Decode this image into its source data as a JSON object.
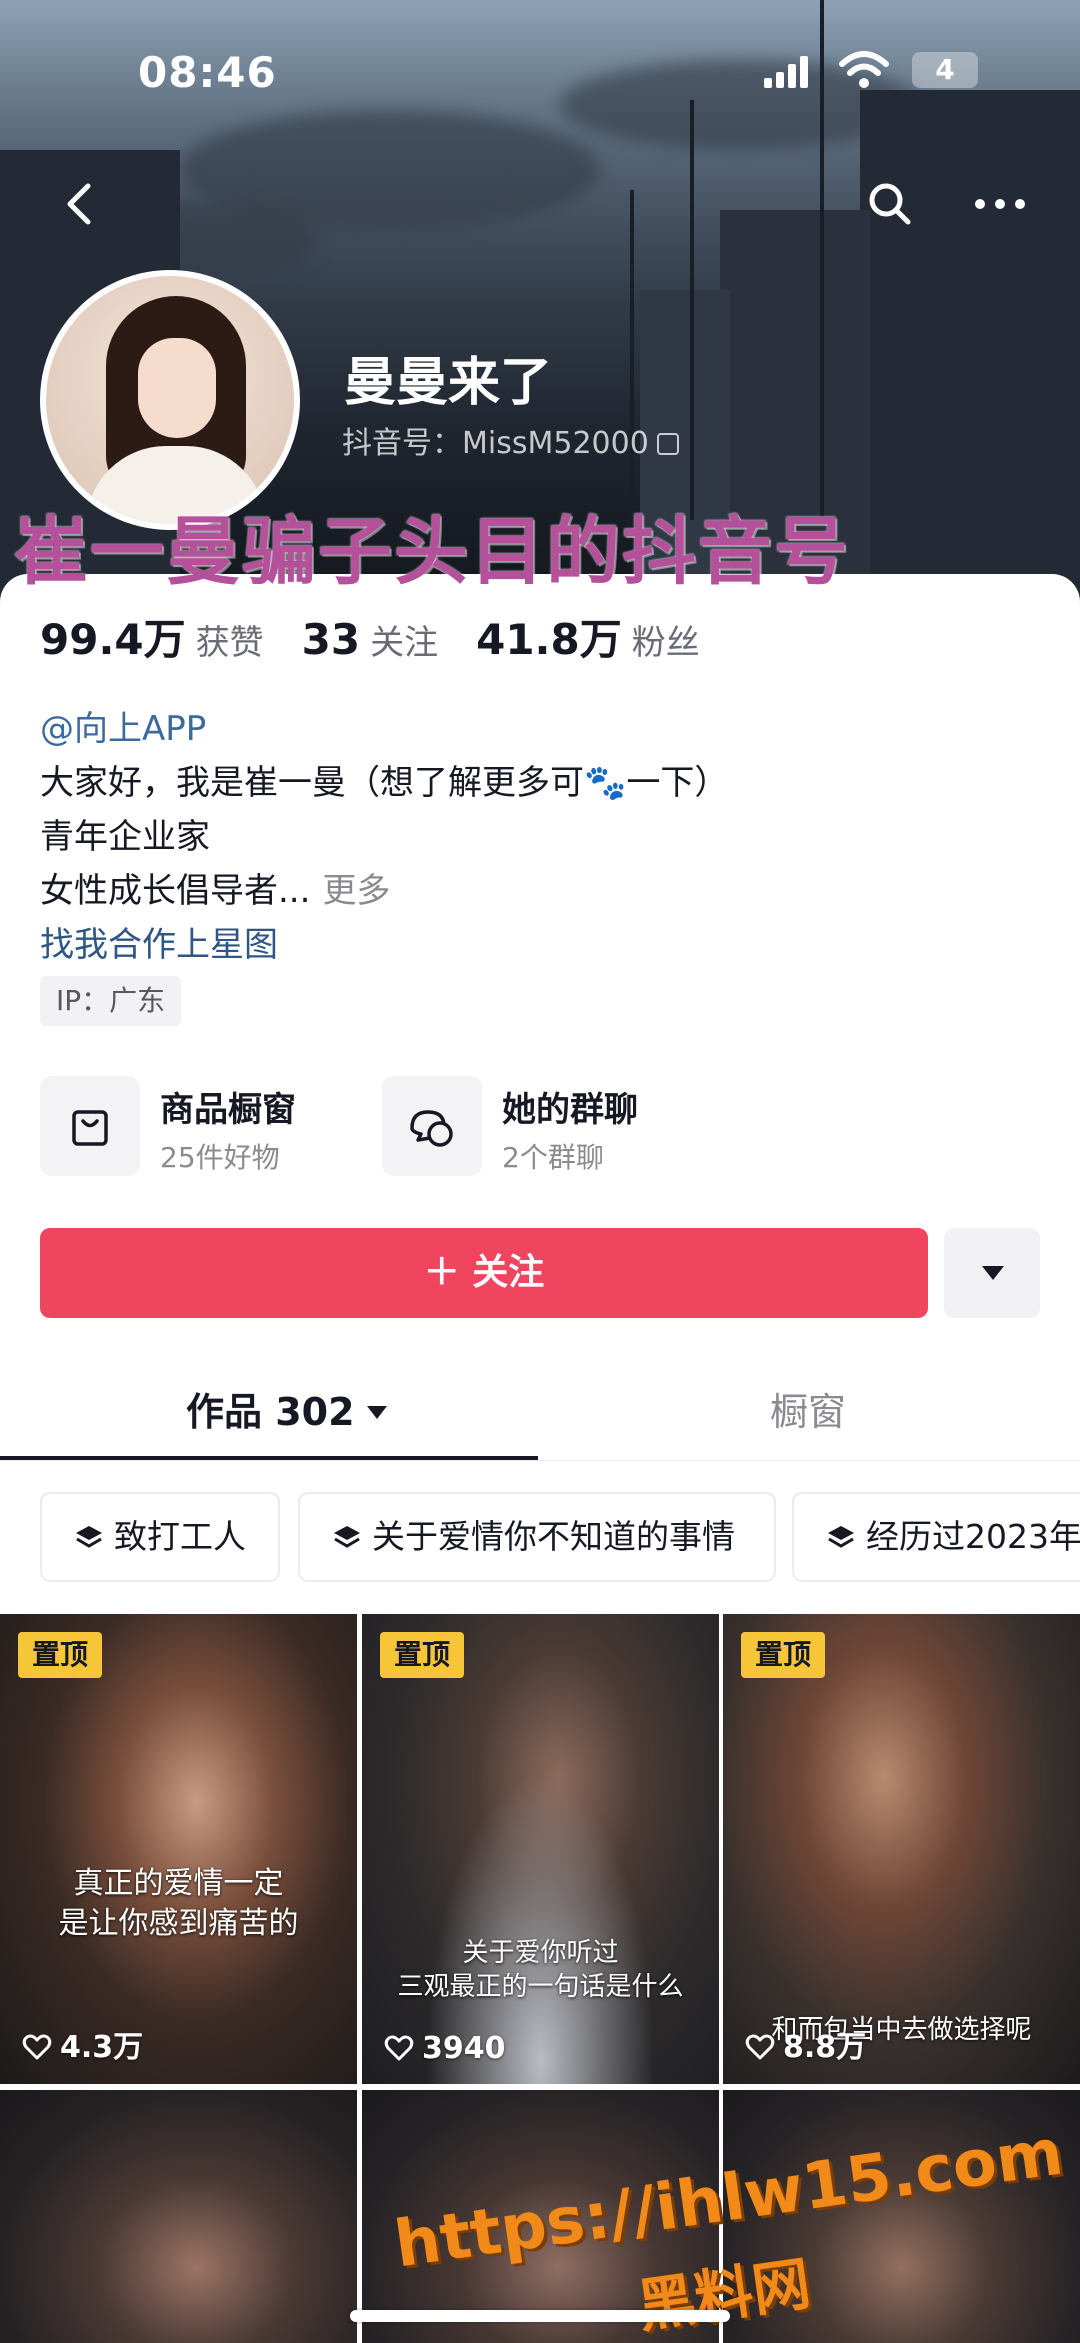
{
  "status_bar": {
    "time": "08:46",
    "battery": "4"
  },
  "profile": {
    "nickname": "曼曼来了",
    "douyin_id": "抖音号：MissM52000"
  },
  "overlay_banner": "崔一曼骗子头目的抖音号",
  "stats": [
    {
      "value": "99.4万",
      "label": "获赞"
    },
    {
      "value": "33",
      "label": "关注"
    },
    {
      "value": "41.8万",
      "label": "粉丝"
    }
  ],
  "bio": {
    "mention": "@向上APP",
    "line1": "大家好，我是崔一曼（想了解更多可🐾一下）",
    "line2": "青年企业家",
    "line3": "女性成长倡导者...",
    "more": "更多",
    "link": "找我合作上星图"
  },
  "ip_tag": "IP：广东",
  "services": [
    {
      "title": "商品橱窗",
      "subtitle": "25件好物",
      "icon": "shopping-bag-icon"
    },
    {
      "title": "她的群聊",
      "subtitle": "2个群聊",
      "icon": "chat-bubbles-icon"
    }
  ],
  "follow_button": "＋ 关注",
  "tabs": [
    {
      "label": "作品 302"
    },
    {
      "label": "橱窗"
    }
  ],
  "collections": [
    "致打工人",
    "关于爱情你不知道的事情",
    "经历过2023年"
  ],
  "videos": [
    {
      "pinned": "置顶",
      "caption": [
        "真正的爱情一定",
        "是让你感到痛苦的"
      ],
      "likes": "4.3万"
    },
    {
      "pinned": "置顶",
      "caption": [
        "关于爱你听过",
        "三观最正的一句话是什么"
      ],
      "likes": "3940"
    },
    {
      "pinned": "置顶",
      "caption": [
        "和而包当中去做选择呢"
      ],
      "likes": "8.8万"
    }
  ],
  "watermark": {
    "url": "https://ihlw15.com",
    "name": "黑料网"
  },
  "colors": {
    "follow": "#f0455f",
    "pin": "#f6c538",
    "banner": "#b5509a",
    "watermark": "#f28a1a"
  }
}
